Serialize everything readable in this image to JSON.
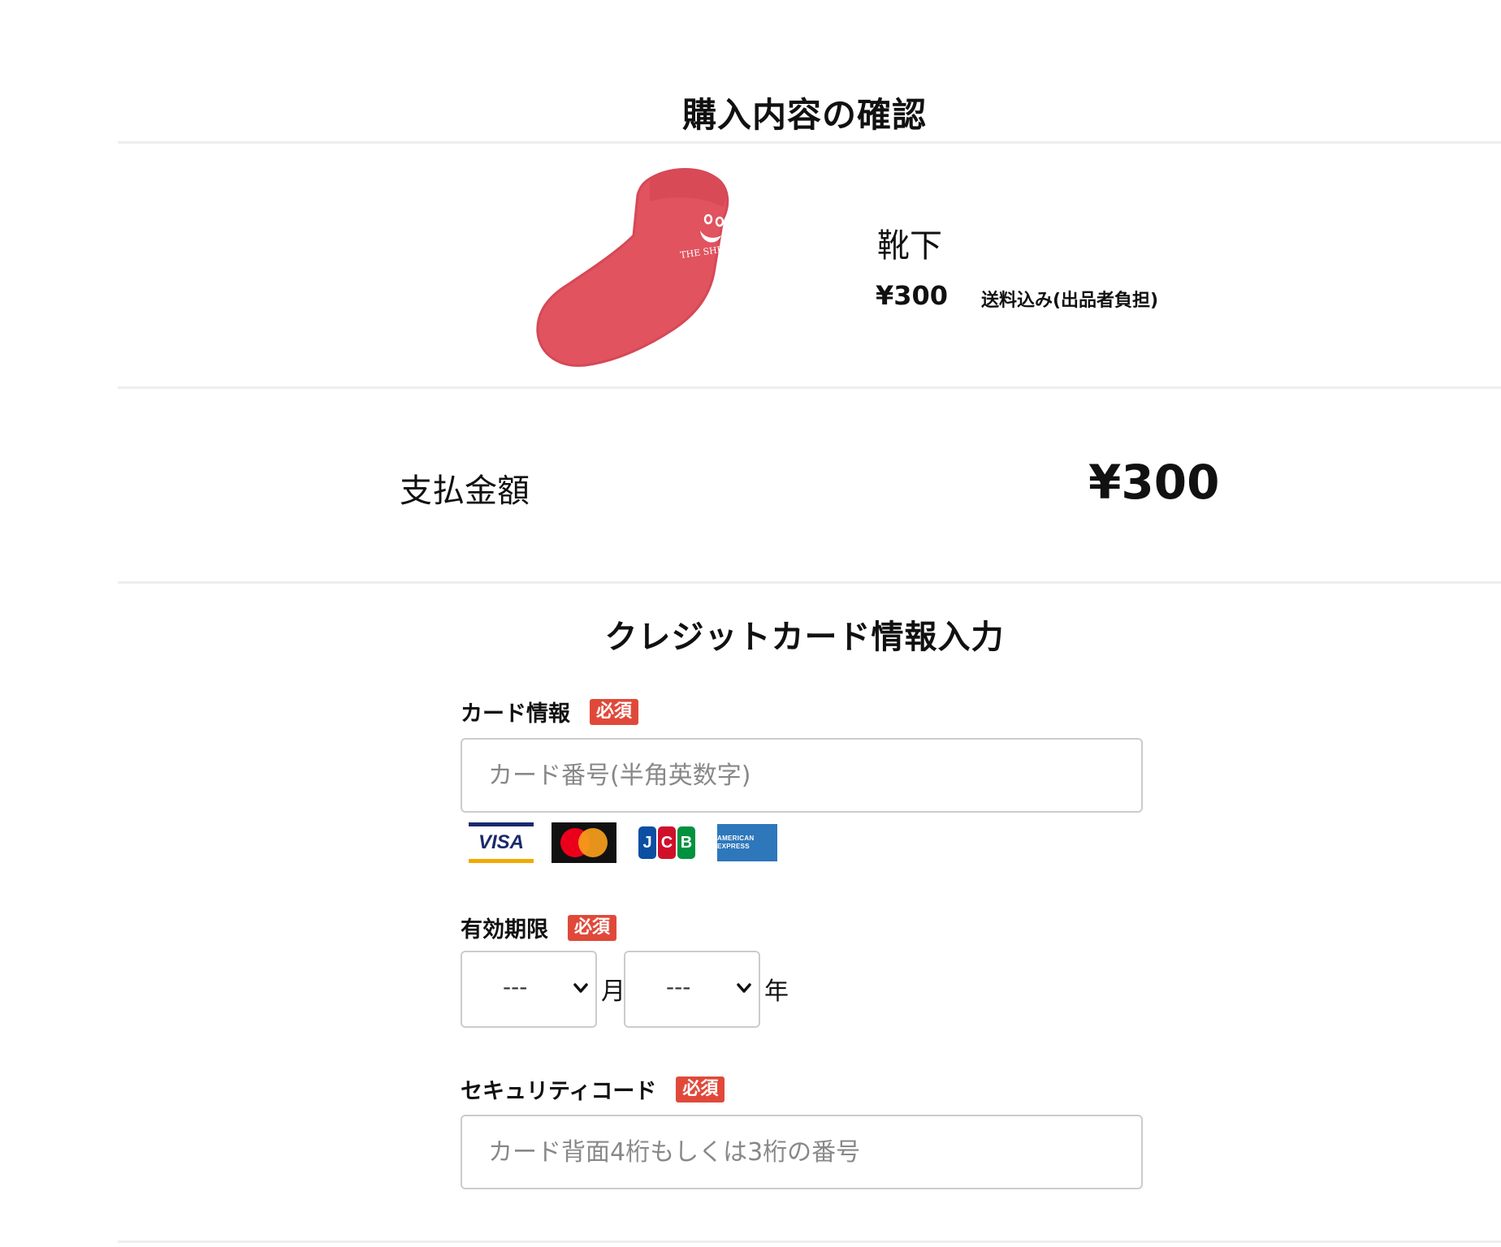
{
  "page_title": "購入内容の確認",
  "product": {
    "name": "靴下",
    "price": "¥300",
    "shipping_note": "送料込み(出品者負担)",
    "image_text": "THE SHIRT ROOM"
  },
  "total": {
    "label": "支払金額",
    "value": "¥300"
  },
  "credit_card": {
    "section_title": "クレジットカード情報入力",
    "required_badge": "必須",
    "card_info": {
      "label": "カード情報",
      "placeholder": "カード番号(半角英数字)"
    },
    "card_brands": [
      "VISA",
      "MasterCard",
      "JCB",
      "AMERICAN EXPRESS"
    ],
    "expiry": {
      "label": "有効期限",
      "month_value": "---",
      "month_unit": "月",
      "year_value": "---",
      "year_unit": "年"
    },
    "security_code": {
      "label": "セキュリティコード",
      "placeholder": "カード背面4桁もしくは3桁の番号"
    }
  },
  "colors": {
    "required_badge": "#e0493a",
    "sock": "#e0535f",
    "divider": "#eeeeee"
  }
}
